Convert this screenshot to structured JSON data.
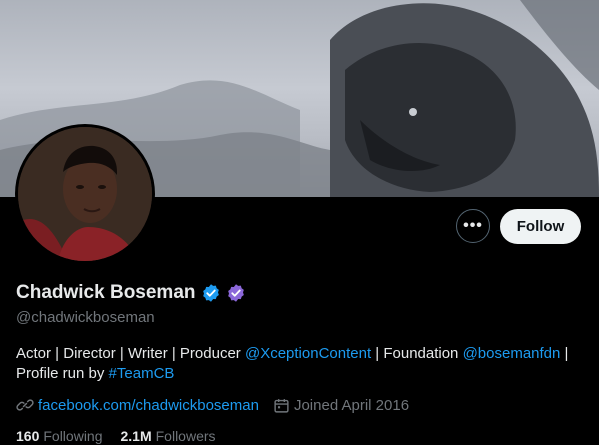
{
  "profile": {
    "name": "Chadwick Boseman",
    "handle": "@chadwickboseman",
    "bio": {
      "t1": "Actor | Director | Writer | Producer ",
      "m1": "@XceptionContent",
      "t2": " | Foundation ",
      "m2": "@bosemanfdn",
      "t3": " |",
      "t4": "Profile run by ",
      "h1": "#TeamCB"
    },
    "website": "facebook.com/chadwickboseman",
    "joined": "Joined April 2016",
    "following_count": "160",
    "following_label": "Following",
    "followers_count": "2.1M",
    "followers_label": "Followers"
  },
  "actions": {
    "more": "•••",
    "follow": "Follow"
  },
  "colors": {
    "accent": "#1d9bf0",
    "verified_blue": "#1d9bf0",
    "purple_badge": "#8b67d9",
    "muted": "#71767b"
  },
  "icons": [
    "verified-badge-icon",
    "purple-check-badge-icon",
    "link-icon",
    "calendar-icon",
    "more-icon"
  ]
}
